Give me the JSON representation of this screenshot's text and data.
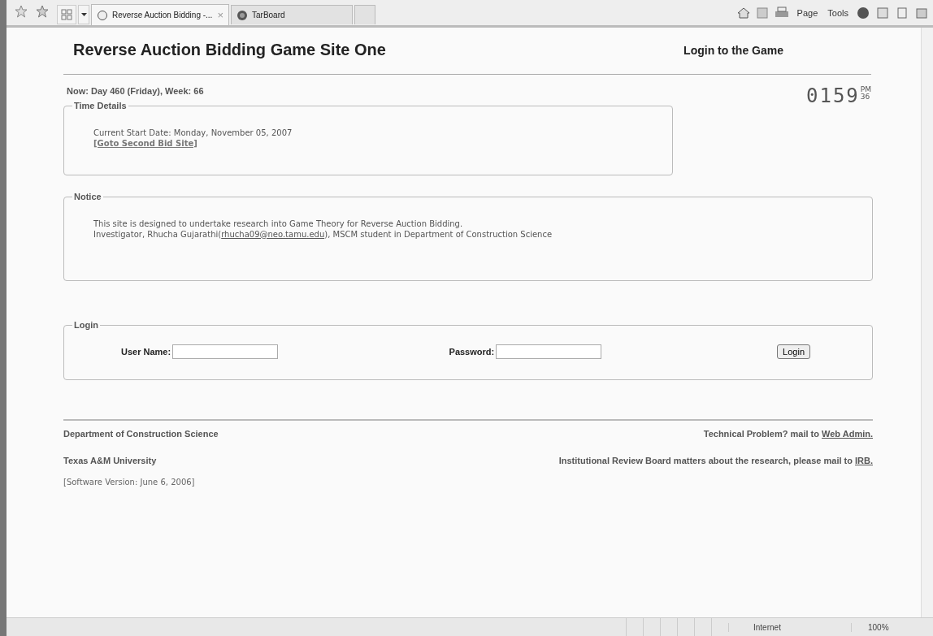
{
  "browser": {
    "tabs": [
      {
        "label": "Reverse Auction Bidding -...",
        "selected": true,
        "kind": "page"
      },
      {
        "label": "TarBoard",
        "selected": false,
        "kind": "globe"
      }
    ],
    "close_tab": "×",
    "tools": [
      {
        "label": "Page"
      },
      {
        "label": "Tools"
      }
    ]
  },
  "header": {
    "title": "Reverse Auction Bidding Game Site One",
    "login_heading": "Login to the Game"
  },
  "now": "Now:  Day 460  (Friday),  Week: 66",
  "clock": {
    "time": "0159",
    "ampm": "PM",
    "seconds": "36"
  },
  "time_details": {
    "legend": "Time Details",
    "start_date": "Current Start Date: Monday, November 05, 2007",
    "link": "[Goto Second Bid Site]"
  },
  "notice": {
    "legend": "Notice",
    "line1": "This site is designed to undertake research into Game Theory for Reverse Auction Bidding.",
    "line2_before": "Investigator, Rhucha Gujarathi(",
    "email": "rhucha09@neo.tamu.edu",
    "line2_after": "), MSCM student in Department of Construction Science"
  },
  "login": {
    "legend": "Login",
    "user_label": "User Name:",
    "password_label": "Password:",
    "button": "Login"
  },
  "footer": {
    "department": "Department of Construction Science",
    "tech_text": "Technical Problem? mail to",
    "tech_link": "Web Admin.",
    "university": "Texas A&M University",
    "irb_text": "Institutional Review Board matters about the research, please mail to",
    "irb_link": "IRB.",
    "version": "[Software Version: June 6, 2006]"
  },
  "status_bar": {
    "zone": "Internet",
    "zoom": "100%"
  }
}
